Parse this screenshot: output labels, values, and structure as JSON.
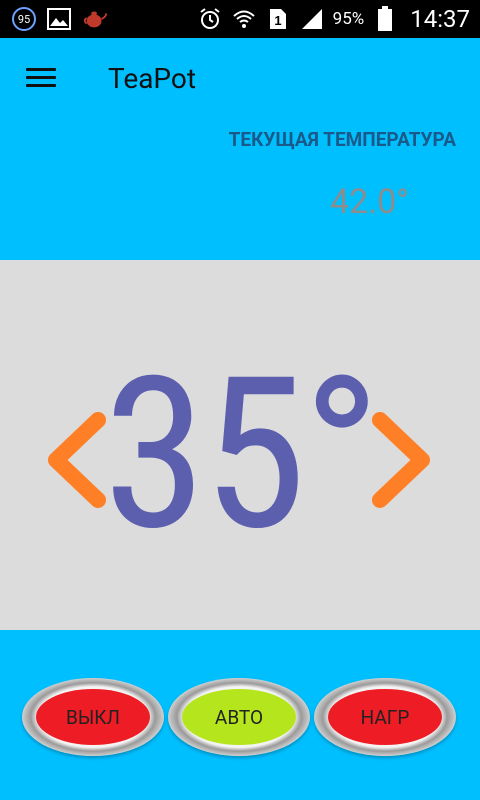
{
  "status_bar": {
    "notification_count": "95",
    "notification_icons": [
      "image-icon",
      "teapot-icon"
    ],
    "status_icons": [
      "alarm-icon",
      "wifi-icon",
      "sim-1-icon",
      "signal-icon"
    ],
    "battery_percent": "95%",
    "time": "14:37"
  },
  "app_bar": {
    "title": "TeaPot",
    "menu_icon": "hamburger-menu-icon"
  },
  "current_temperature": {
    "label": "ТЕКУЩАЯ ТЕМПЕРАТУРА",
    "value": "42.0°"
  },
  "target_temperature": {
    "value": "35°",
    "decrease_icon": "chevron-left-icon",
    "increase_icon": "chevron-right-icon"
  },
  "controls": {
    "off_label": "ВЫКЛ",
    "auto_label": "АВТО",
    "heat_label": "НАГР"
  },
  "colors": {
    "background": "#00bfff",
    "panel": "#dcdcdc",
    "target_text": "#5b5fae",
    "arrows": "#ff7f27",
    "off_button": "#ee1c24",
    "auto_button": "#b5e61d",
    "heat_button": "#ee1c24",
    "label_text": "#1a5a8a"
  }
}
